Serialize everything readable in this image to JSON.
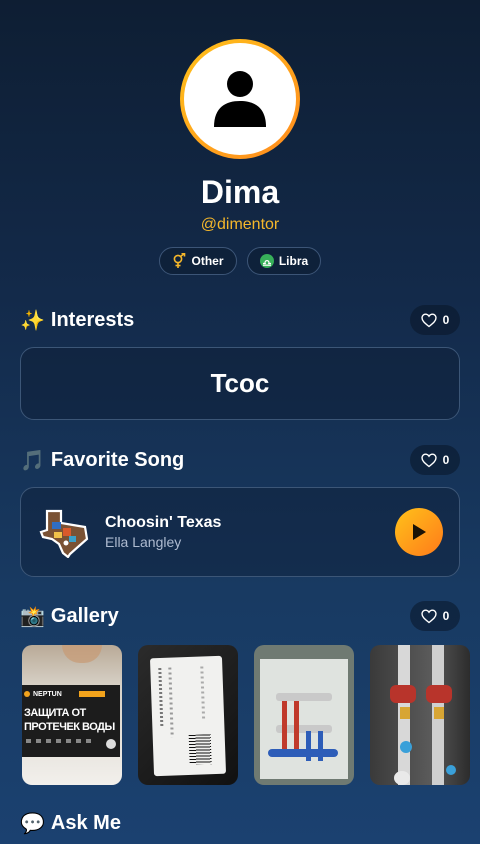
{
  "profile": {
    "name": "Dima",
    "username": "@dimentor",
    "avatar_icon": "person-icon",
    "badges": [
      {
        "label": "Other",
        "icon": "gender-other-icon"
      },
      {
        "label": "Libra",
        "icon": "libra-icon"
      }
    ]
  },
  "interests": {
    "emoji": "✨",
    "title": "Interests",
    "likes": "0",
    "value": "Tcoc"
  },
  "favorite_song": {
    "emoji": "🎵",
    "title": "Favorite Song",
    "likes": "0",
    "song_title": "Choosin' Texas",
    "artist": "Ella Langley",
    "cover_icon": "texas-cover-icon",
    "play_icon": "play-icon"
  },
  "gallery": {
    "emoji": "📸",
    "title": "Gallery",
    "likes": "0",
    "photo1_text": [
      "NEPTUN",
      "ЗАЩИТА ОТ",
      "ПРОТЕЧЕК ВОДЫ"
    ]
  },
  "ask_me": {
    "emoji": "💬",
    "title": "Ask Me"
  },
  "colors": {
    "accent": "#f5b72b",
    "play_button": "#ff8a1e",
    "background_top": "#0e1e33",
    "background_bottom": "#1b4170"
  }
}
